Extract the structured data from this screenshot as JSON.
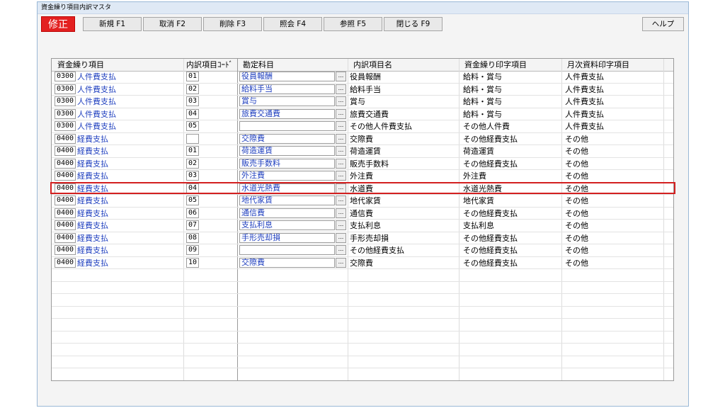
{
  "window": {
    "title": "資金繰り項目内訳マスタ"
  },
  "mode": {
    "label": "修正",
    "color": "#e32020"
  },
  "toolbar": {
    "buttons": [
      {
        "label": "新規 F1"
      },
      {
        "label": "取消 F2"
      },
      {
        "label": "削除 F3"
      },
      {
        "label": "照会 F4"
      },
      {
        "label": "参照 F5"
      },
      {
        "label": "閉じる F9"
      }
    ],
    "help_label": "ヘルプ"
  },
  "grid": {
    "headers": [
      "資金繰り項目",
      "内訳項目ｺｰﾄﾞ",
      "勘定科目",
      "内訳項目名",
      "資金繰り印字項目",
      "月次資料印字項目"
    ],
    "lookup_button": "...",
    "highlighted_row": 10,
    "rows": [
      {
        "code": "0300",
        "item": "人件費支払",
        "sub": "01",
        "account": "役員報酬",
        "name": "役員報酬",
        "print": "給料・賞与",
        "monthly": "人件費支払"
      },
      {
        "code": "0300",
        "item": "人件費支払",
        "sub": "02",
        "account": "給料手当",
        "name": "給料手当",
        "print": "給料・賞与",
        "monthly": "人件費支払"
      },
      {
        "code": "0300",
        "item": "人件費支払",
        "sub": "03",
        "account": "賞与",
        "name": "賞与",
        "print": "給料・賞与",
        "monthly": "人件費支払"
      },
      {
        "code": "0300",
        "item": "人件費支払",
        "sub": "04",
        "account": "旅費交通費",
        "name": "旅費交通費",
        "print": "給料・賞与",
        "monthly": "人件費支払"
      },
      {
        "code": "0300",
        "item": "人件費支払",
        "sub": "05",
        "account": "",
        "name": "その他人件費支払",
        "print": "その他人件費",
        "monthly": "人件費支払"
      },
      {
        "code": "0400",
        "item": "経費支払",
        "sub": "",
        "account": "交際費",
        "name": "交際費",
        "print": "その他経費支払",
        "monthly": "その他"
      },
      {
        "code": "0400",
        "item": "経費支払",
        "sub": "01",
        "account": "荷造運賃",
        "name": "荷造運賃",
        "print": "荷造運賃",
        "monthly": "その他"
      },
      {
        "code": "0400",
        "item": "経費支払",
        "sub": "02",
        "account": "販売手数料",
        "name": "販売手数料",
        "print": "その他経費支払",
        "monthly": "その他"
      },
      {
        "code": "0400",
        "item": "経費支払",
        "sub": "03",
        "account": "外注費",
        "name": "外注費",
        "print": "外注費",
        "monthly": "その他"
      },
      {
        "code": "0400",
        "item": "経費支払",
        "sub": "04",
        "account": "水道光熱費",
        "name": "水道費",
        "print": "水道光熱費",
        "monthly": "その他"
      },
      {
        "code": "0400",
        "item": "経費支払",
        "sub": "05",
        "account": "地代家賃",
        "name": "地代家賃",
        "print": "地代家賃",
        "monthly": "その他"
      },
      {
        "code": "0400",
        "item": "経費支払",
        "sub": "06",
        "account": "通信費",
        "name": "通信費",
        "print": "その他経費支払",
        "monthly": "その他"
      },
      {
        "code": "0400",
        "item": "経費支払",
        "sub": "07",
        "account": "支払利息",
        "name": "支払利息",
        "print": "支払利息",
        "monthly": "その他"
      },
      {
        "code": "0400",
        "item": "経費支払",
        "sub": "08",
        "account": "手形売却損",
        "name": "手形売却損",
        "print": "その他経費支払",
        "monthly": "その他"
      },
      {
        "code": "0400",
        "item": "経費支払",
        "sub": "09",
        "account": "",
        "name": "その他経費支払",
        "print": "その他経費支払",
        "monthly": "その他"
      },
      {
        "code": "0400",
        "item": "経費支払",
        "sub": "10",
        "account": "交際費",
        "name": "交際費",
        "print": "その他経費支払",
        "monthly": "その他"
      }
    ]
  }
}
